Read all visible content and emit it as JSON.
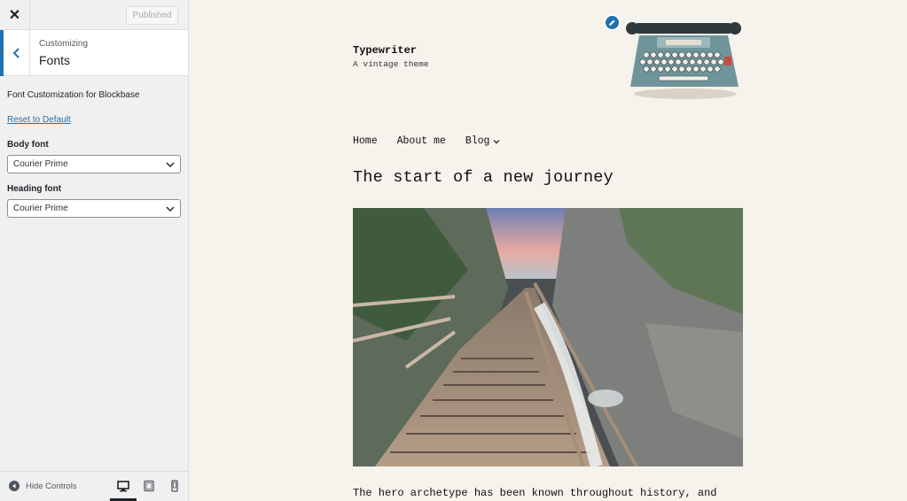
{
  "sidebar": {
    "close_icon": "close-icon",
    "published_label": "Published",
    "section_parent": "Customizing",
    "section_title": "Fonts",
    "description": "Font Customization for Blockbase",
    "reset_label": "Reset to Default",
    "body_font_label": "Body font",
    "body_font_value": "Courier Prime",
    "heading_font_label": "Heading font",
    "heading_font_value": "Courier Prime",
    "hide_controls_label": "Hide Controls",
    "devices": [
      "desktop-icon",
      "tablet-icon",
      "mobile-icon"
    ],
    "accent_color": "#2271b1"
  },
  "preview": {
    "site_title": "Typewriter",
    "site_tagline": "A vintage theme",
    "nav": [
      "Home",
      "About me",
      "Blog"
    ],
    "post_title": "The start of a new journey",
    "excerpt": "The hero archetype has been known throughout history, and",
    "background_color": "#f6f2ec"
  }
}
